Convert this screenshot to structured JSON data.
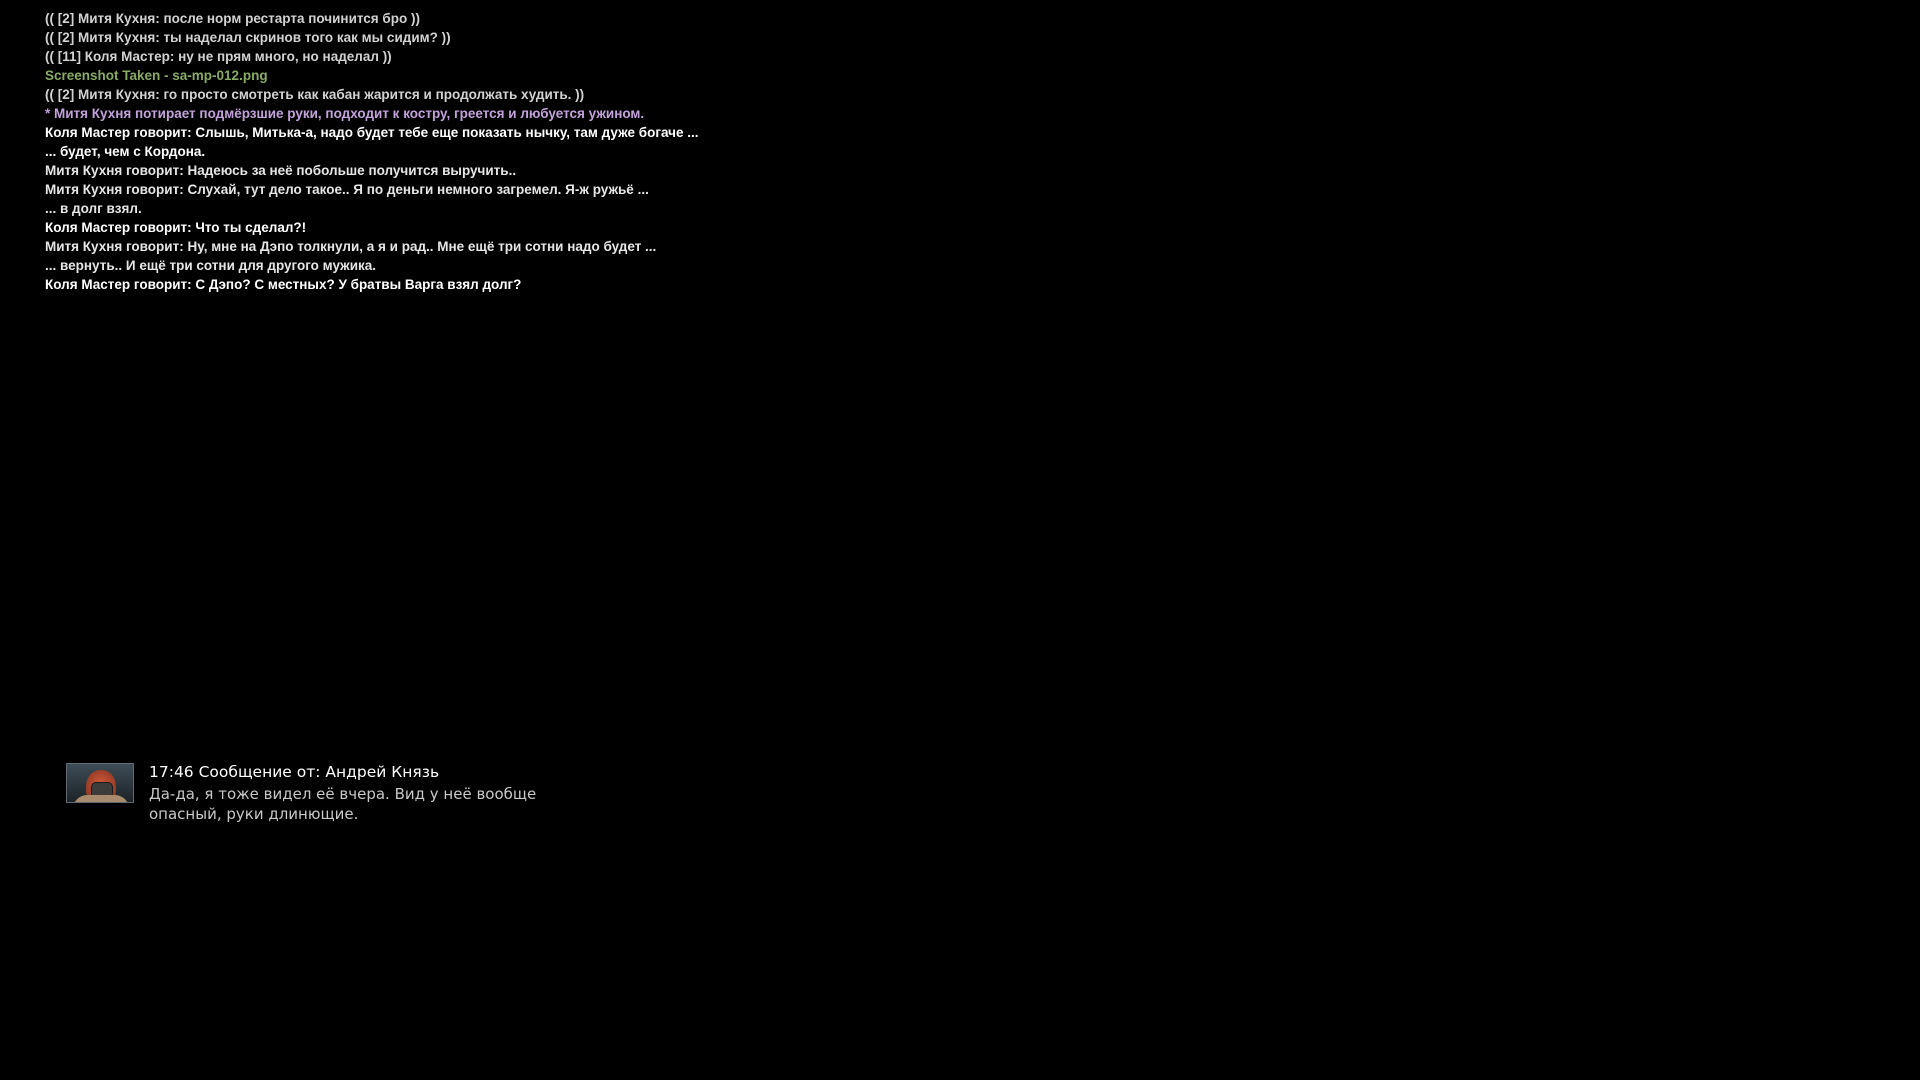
{
  "chat": {
    "lines": [
      {
        "text": "(( [2] Митя Кухня: после норм рестарта починится бро ))",
        "color": "#d2d2d2"
      },
      {
        "text": "(( [2] Митя Кухня: ты наделал скринов того как мы сидим? ))",
        "color": "#d2d2d2"
      },
      {
        "text": "(( [11] Коля Мастер: ну не прям много, но наделал ))",
        "color": "#d2d2d2"
      },
      {
        "text": "Screenshot Taken - sa-mp-012.png",
        "color": "#88aa62"
      },
      {
        "text": "(( [2] Митя Кухня: го просто смотреть как кабан жарится и продолжать худить. ))",
        "color": "#d2d2d2"
      },
      {
        "text": "* Митя Кухня потирает подмёрзшие руки, подходит к костру, греется и любуется ужином.",
        "color": "#c2a2da"
      },
      {
        "text": "Коля Мастер говорит: Слышь, Митька-а, надо будет тебе еще показать нычку, там дуже богаче  ...",
        "color": "#ffffff"
      },
      {
        "text": "... будет, чем с Кордона.",
        "color": "#ffffff"
      },
      {
        "text": "Митя Кухня говорит: Надеюсь за неё побольше получится выручить..",
        "color": "#e6e6e6"
      },
      {
        "text": "Митя Кухня говорит: Слухай, тут дело такое.. Я по деньги немного загремел. Я-ж ружьё  ...",
        "color": "#e6e6e6"
      },
      {
        "text": "... в долг взял.",
        "color": "#e6e6e6"
      },
      {
        "text": "Коля Мастер говорит: Что ты сделал?!",
        "color": "#ffffff"
      },
      {
        "text": "Митя Кухня говорит: Ну, мне на Дэпо толкнули, а я и рад.. Мне ещё три сотни надо будет  ...",
        "color": "#e6e6e6"
      },
      {
        "text": "... вернуть.. И ещё три сотни для другого мужика.",
        "color": "#e6e6e6"
      },
      {
        "text": "Коля Мастер говорит: С Дэпо? С местных? У братвы Варга взял долг?",
        "color": "#ffffff"
      }
    ]
  },
  "notification": {
    "header": "17:46 Сообщение от: Андрей Князь",
    "body": "Да-да, я тоже видел её вчера. Вид у неё вообще\nопасный, руки длинющие.",
    "avatar_icon": "masked-stalker-avatar-icon"
  }
}
